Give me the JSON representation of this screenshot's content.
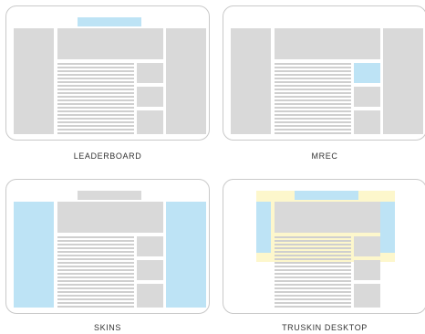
{
  "layouts": [
    {
      "name": "LEADERBOARD",
      "highlighted_areas": [
        "leaderboard"
      ]
    },
    {
      "name": "MREC",
      "highlighted_areas": [
        "mrec"
      ]
    },
    {
      "name": "SKINS",
      "highlighted_areas": [
        "left-skin",
        "right-skin"
      ]
    },
    {
      "name": "TRUSKIN DESKTOP",
      "highlighted_areas": [
        "top-banner",
        "frame",
        "left-skin",
        "right-skin"
      ]
    }
  ],
  "colors": {
    "ad_blue": "#bde3f5",
    "ad_yellow": "#fdf7cc",
    "placeholder_gray": "#d9d9d9",
    "border": "#c9c9c9"
  }
}
